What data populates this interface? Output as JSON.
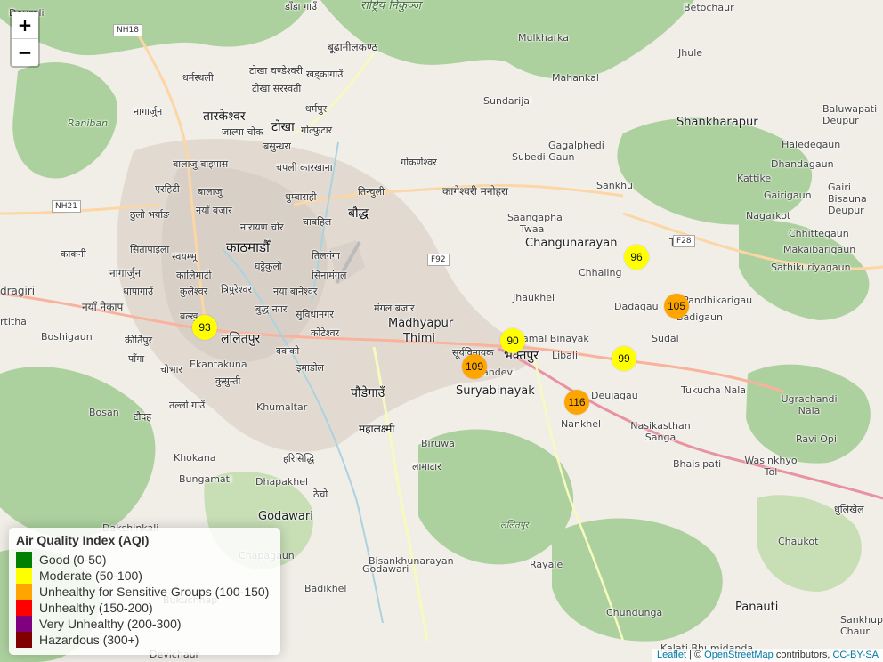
{
  "map": {
    "zoom_in_label": "+",
    "zoom_out_label": "−",
    "places": [
      {
        "text": "Deurali"
      },
      {
        "text": "डाँडा गाउँ"
      },
      {
        "text": "राष्ट्रिय निकुञ्ज"
      },
      {
        "text": "Betochaur"
      },
      {
        "text": "बूढानीलकण्ठ"
      },
      {
        "text": "Mulkharka"
      },
      {
        "text": "Jhule"
      },
      {
        "text": "धर्मस्थली"
      },
      {
        "text": "टोखा चण्डेश्वरी"
      },
      {
        "text": "खड्कागाउँ"
      },
      {
        "text": "टोखा सरस्वती"
      },
      {
        "text": "Mahankal"
      },
      {
        "text": "Raniban"
      },
      {
        "text": "नागार्जुन"
      },
      {
        "text": "तारकेश्वर"
      },
      {
        "text": "धर्मपुर"
      },
      {
        "text": "Sundarijal"
      },
      {
        "text": "Shankharapur"
      },
      {
        "text": "Baluwapati Deupur"
      },
      {
        "text": "जाल्पा चोक"
      },
      {
        "text": "टोखा"
      },
      {
        "text": "गोल्फुटार"
      },
      {
        "text": "Gagalphedi"
      },
      {
        "text": "बसुन्धरा"
      },
      {
        "text": "Haledegaun"
      },
      {
        "text": "बालाजु बाइपास"
      },
      {
        "text": "चपली कारखाना"
      },
      {
        "text": "Subedi Gaun"
      },
      {
        "text": "गोकर्णेश्वर"
      },
      {
        "text": "Dhandagaun"
      },
      {
        "text": "Kattike"
      },
      {
        "text": "एरहिटी"
      },
      {
        "text": "बालाजु"
      },
      {
        "text": "धुम्बाराही"
      },
      {
        "text": "तिन्चुली"
      },
      {
        "text": "कागेश्वरी मनोहरा"
      },
      {
        "text": "Sankhu"
      },
      {
        "text": "Gairigaun"
      },
      {
        "text": "Gairi Bisauna Deupur"
      },
      {
        "text": "ठुलो भर्याङ"
      },
      {
        "text": "नयाँ बजार"
      },
      {
        "text": "नारायण चोर"
      },
      {
        "text": "चाबहिल"
      },
      {
        "text": "बौद्ध"
      },
      {
        "text": "Saangapha"
      },
      {
        "text": "Nagarkot"
      },
      {
        "text": "Twaa"
      },
      {
        "text": "Chhittegaun"
      },
      {
        "text": "सितापाइला"
      },
      {
        "text": "काठमाडौँ"
      },
      {
        "text": "Changunarayan"
      },
      {
        "text": "Tusal"
      },
      {
        "text": "काकनी"
      },
      {
        "text": "स्वयम्भू"
      },
      {
        "text": "तिलगंगा"
      },
      {
        "text": "Makaibarigaun"
      },
      {
        "text": "नागार्जुन"
      },
      {
        "text": "कालिमाटी"
      },
      {
        "text": "घट्टेकुलो"
      },
      {
        "text": "Sathikuriyagaun"
      },
      {
        "text": "Chhaling"
      },
      {
        "text": "dragiri"
      },
      {
        "text": "थापागाउँ"
      },
      {
        "text": "कुलेश्वर"
      },
      {
        "text": "त्रिपुरेश्वर"
      },
      {
        "text": "नया बानेश्वर"
      },
      {
        "text": "सिनामंगल"
      },
      {
        "text": "नयाँ नैकाप"
      },
      {
        "text": "Jhaukhel"
      },
      {
        "text": "Pandhikarigau"
      },
      {
        "text": "बल्खु"
      },
      {
        "text": "बुद्ध नगर"
      },
      {
        "text": "सुविधानगर"
      },
      {
        "text": "मंगल बजार"
      },
      {
        "text": "Dadagau"
      },
      {
        "text": "Badigaun"
      },
      {
        "text": "Madhyapur Thimi"
      },
      {
        "text": "rtitha"
      },
      {
        "text": "Boshigaun"
      },
      {
        "text": "ललितपुर"
      },
      {
        "text": "कोटेश्वर"
      },
      {
        "text": "Kamal Binayak"
      },
      {
        "text": "Sudal"
      },
      {
        "text": "कीर्तिपुर"
      },
      {
        "text": "क्वाको"
      },
      {
        "text": "सूर्यविनायक"
      },
      {
        "text": "भक्तपुर"
      },
      {
        "text": "Libali"
      },
      {
        "text": "पाँगा"
      },
      {
        "text": "Ekantakuna"
      },
      {
        "text": "इमाडोल"
      },
      {
        "text": "Sandevi"
      },
      {
        "text": "चोभार"
      },
      {
        "text": "कुसुन्ती"
      },
      {
        "text": "पौडेगाउँ"
      },
      {
        "text": "Suryabinayak"
      },
      {
        "text": "Deujagau"
      },
      {
        "text": "Tukucha Nala"
      },
      {
        "text": "Ugrachandi Nala"
      },
      {
        "text": "तल्लो गाउँ"
      },
      {
        "text": "Khumaltar"
      },
      {
        "text": "Bosan"
      },
      {
        "text": "टौदह"
      },
      {
        "text": "Nankhel"
      },
      {
        "text": "Nasikasthan Sanga"
      },
      {
        "text": "Ravi Opi"
      },
      {
        "text": "महालक्ष्मी"
      },
      {
        "text": "Biruwa"
      },
      {
        "text": "Khokana"
      },
      {
        "text": "हरिसिद्धि"
      },
      {
        "text": "लामाटार"
      },
      {
        "text": "Bhaisipati"
      },
      {
        "text": "Wasinkhyo Tol"
      },
      {
        "text": "Bungamati"
      },
      {
        "text": "Dhapakhel"
      },
      {
        "text": "ठेचो"
      },
      {
        "text": "Godawari"
      },
      {
        "text": "धुलिखेल"
      },
      {
        "text": "ललितपुर"
      },
      {
        "text": "Dakshinkali"
      },
      {
        "text": "Chapagaun"
      },
      {
        "text": "Bisankhunarayan"
      },
      {
        "text": "Chaukot"
      },
      {
        "text": "Godawari"
      },
      {
        "text": "Rayale"
      },
      {
        "text": "Badikhel"
      },
      {
        "text": "Bukuchhap"
      },
      {
        "text": "Chundunga"
      },
      {
        "text": "Panauti"
      },
      {
        "text": "Devichaur"
      },
      {
        "text": "Sankhupati Chaur"
      },
      {
        "text": "Kalati Bhumidanda"
      }
    ],
    "route_shields": [
      {
        "text": "NH18"
      },
      {
        "text": "NH21"
      },
      {
        "text": "F92"
      },
      {
        "text": "F28"
      }
    ]
  },
  "markers": [
    {
      "aqi": "93",
      "level": "moderate"
    },
    {
      "aqi": "96",
      "level": "moderate"
    },
    {
      "aqi": "105",
      "level": "sensitive"
    },
    {
      "aqi": "90",
      "level": "moderate"
    },
    {
      "aqi": "99",
      "level": "moderate"
    },
    {
      "aqi": "109",
      "level": "sensitive"
    },
    {
      "aqi": "116",
      "level": "sensitive"
    }
  ],
  "legend": {
    "title": "Air Quality Index (AQI)",
    "items": [
      {
        "label": "Good (0-50)",
        "color": "#008000"
      },
      {
        "label": "Moderate (50-100)",
        "color": "#FFFF00"
      },
      {
        "label": "Unhealthy for Sensitive Groups (100-150)",
        "color": "#FFA500"
      },
      {
        "label": "Unhealthy (150-200)",
        "color": "#FF0000"
      },
      {
        "label": "Very Unhealthy (200-300)",
        "color": "#800080"
      },
      {
        "label": "Hazardous (300+)",
        "color": "#800000"
      }
    ]
  },
  "colors": {
    "moderate": "#FFFF00",
    "sensitive": "#FFA500"
  },
  "attribution": {
    "leaflet": "Leaflet",
    "sep": " | © ",
    "osm": "OpenStreetMap",
    "contrib": " contributors, ",
    "license": "CC-BY-SA"
  }
}
